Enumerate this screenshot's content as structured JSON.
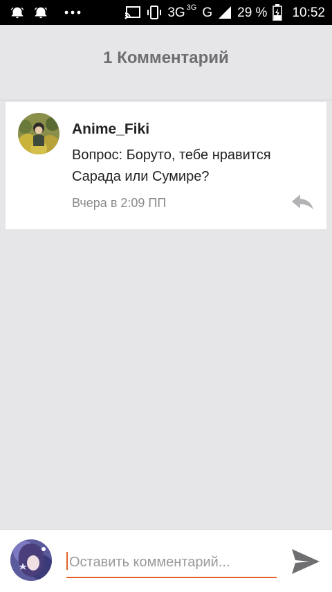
{
  "status_bar": {
    "network_type": "3G",
    "network_type_small": "3G",
    "network_letter": "G",
    "battery_percent": "29 %",
    "time": "10:52",
    "icons": [
      "alarm-icon",
      "alarm-icon",
      "more-dots-icon",
      "cast-icon",
      "vibrate-icon",
      "signal-icon",
      "battery-charging-icon"
    ]
  },
  "header": {
    "title": "1 Комментарий"
  },
  "comment": {
    "author": "Anime_Fiki",
    "text": "Вопрос: Боруто, тебе нравится Сарада или Сумире?",
    "timestamp": "Вчера в 2:09 ПП",
    "reply_icon": "reply-icon"
  },
  "composer": {
    "placeholder": "Оставить комментарий...",
    "value": "",
    "send_icon": "send-icon"
  },
  "colors": {
    "accent": "#e2612b",
    "background": "#e6e5e8",
    "status_bar": "#000000"
  }
}
